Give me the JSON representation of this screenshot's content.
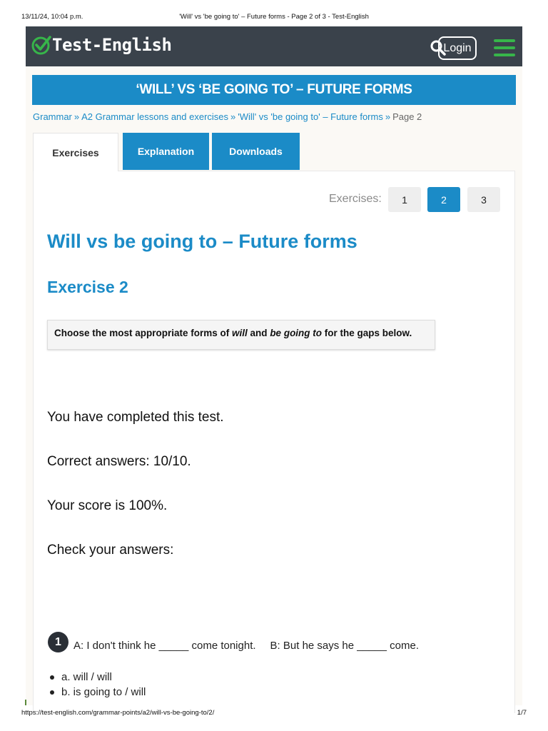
{
  "print": {
    "date": "13/11/24, 10:04 p.m.",
    "title": "'Will' vs 'be going to' – Future forms - Page 2 of 3 - Test-English",
    "url": "https://test-english.com/grammar-points/a2/will-vs-be-going-to/2/",
    "page": "1/7"
  },
  "header": {
    "logo_text": "Test-English",
    "login_label": "Login",
    "icons": [
      "check-circle-icon",
      "search-icon",
      "hamburger-menu-icon"
    ],
    "accent_color": "#37b54a",
    "bg_color": "#3a424b"
  },
  "banner": {
    "title": "‘WILL’ VS ‘BE GOING TO’ – FUTURE FORMS",
    "color": "#1b8bc7"
  },
  "breadcrumb": {
    "items": [
      "Grammar",
      "A2 Grammar lessons and exercises",
      "'Will' vs 'be going to' – Future forms"
    ],
    "separator": "»",
    "current": "Page 2"
  },
  "tabs": [
    {
      "label": "Exercises",
      "active": true
    },
    {
      "label": "Explanation",
      "active": false
    },
    {
      "label": "Downloads",
      "active": false
    }
  ],
  "pagination": {
    "label": "Exercises:",
    "pages": [
      "1",
      "2",
      "3"
    ],
    "current": "2"
  },
  "heading": {
    "part1": "Will",
    "part2": " vs ",
    "part3": "be going to",
    "part4": " – ",
    "part5": "Future forms"
  },
  "exercise_title": "Exercise 2",
  "instruction": {
    "pre": "Choose the most appropriate forms of ",
    "em1": "will",
    "mid": " and ",
    "em2": "be going to",
    "post": " for the gaps below."
  },
  "results": {
    "completed": "You have completed this test.",
    "correct": "Correct answers: 10/10.",
    "score": "Your score is 100%.",
    "check": "Check your answers:"
  },
  "question": {
    "number": "1",
    "part_a": "A: I don't think he _____ come tonight.",
    "part_b": "B: But he says he _____ come.",
    "options": [
      "a. will / will",
      "b. is going to / will"
    ]
  }
}
